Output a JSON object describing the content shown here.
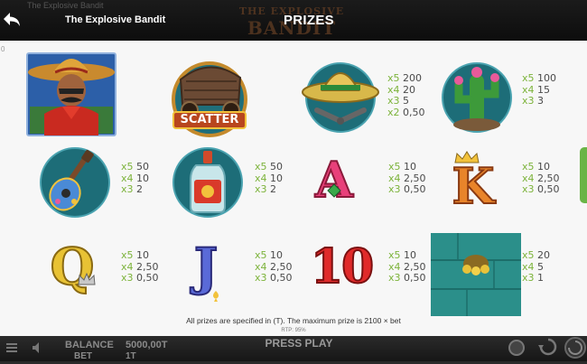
{
  "header": {
    "ghost_title": "The Explosive Bandit",
    "app_title": "The Explosive Bandit",
    "logo_text_top": "THE EXPLOSIVE",
    "logo_text_bottom": "BANDIT",
    "heading": "PRIZES",
    "back_icon": "back-arrow-icon"
  },
  "panel": {
    "edge_zero": "0",
    "symbols": {
      "wild": {
        "icon": "bandit-wild-icon"
      },
      "scatter": {
        "icon": "wagon-scatter-icon",
        "label": "SCATTER"
      },
      "sombrero": {
        "icon": "sombrero-pistols-icon",
        "pays": [
          {
            "mult": "x5",
            "value": "200"
          },
          {
            "mult": "x4",
            "value": "20"
          },
          {
            "mult": "x3",
            "value": "5"
          },
          {
            "mult": "x2",
            "value": "0,50"
          }
        ]
      },
      "cactus": {
        "icon": "cactus-icon",
        "pays": [
          {
            "mult": "x5",
            "value": "100"
          },
          {
            "mult": "x4",
            "value": "15"
          },
          {
            "mult": "x3",
            "value": "3"
          }
        ]
      },
      "guitar": {
        "icon": "guitar-icon",
        "pays": [
          {
            "mult": "x5",
            "value": "50"
          },
          {
            "mult": "x4",
            "value": "10"
          },
          {
            "mult": "x3",
            "value": "2"
          }
        ]
      },
      "bottle": {
        "icon": "tequila-bottle-icon",
        "pays": [
          {
            "mult": "x5",
            "value": "50"
          },
          {
            "mult": "x4",
            "value": "10"
          },
          {
            "mult": "x3",
            "value": "2"
          }
        ]
      },
      "ace": {
        "icon": "ace-card-icon",
        "letter": "A",
        "pays": [
          {
            "mult": "x5",
            "value": "10"
          },
          {
            "mult": "x4",
            "value": "2,50"
          },
          {
            "mult": "x3",
            "value": "0,50"
          }
        ]
      },
      "king": {
        "icon": "king-card-icon",
        "letter": "K",
        "pays": [
          {
            "mult": "x5",
            "value": "10"
          },
          {
            "mult": "x4",
            "value": "2,50"
          },
          {
            "mult": "x3",
            "value": "0,50"
          }
        ]
      },
      "queen": {
        "icon": "queen-card-icon",
        "letter": "Q",
        "pays": [
          {
            "mult": "x5",
            "value": "10"
          },
          {
            "mult": "x4",
            "value": "2,50"
          },
          {
            "mult": "x3",
            "value": "0,50"
          }
        ]
      },
      "jack": {
        "icon": "jack-card-icon",
        "letter": "J",
        "pays": [
          {
            "mult": "x5",
            "value": "10"
          },
          {
            "mult": "x4",
            "value": "2,50"
          },
          {
            "mult": "x3",
            "value": "0,50"
          }
        ]
      },
      "ten": {
        "icon": "ten-card-icon",
        "letter": "10",
        "pays": [
          {
            "mult": "x5",
            "value": "10"
          },
          {
            "mult": "x4",
            "value": "2,50"
          },
          {
            "mult": "x3",
            "value": "0,50"
          }
        ]
      },
      "gold": {
        "icon": "gold-sack-plank-icon",
        "pays": [
          {
            "mult": "x5",
            "value": "20"
          },
          {
            "mult": "x4",
            "value": "5"
          },
          {
            "mult": "x3",
            "value": "1"
          }
        ]
      }
    },
    "note": "All prizes are specified in (T). The maximum prize is 2100 × bet",
    "rtp": "RTP: 95%"
  },
  "footer": {
    "balance_label": "BALANCE",
    "balance_value": "5000,00T",
    "bet_label": "BET",
    "bet_value": "1T",
    "play_label": "PRESS PLAY"
  },
  "colors": {
    "multiplier": "#7cb33a",
    "panel_bg": "#f7f7f7",
    "header_bg": "#111111",
    "side_tab": "#6ab446"
  }
}
